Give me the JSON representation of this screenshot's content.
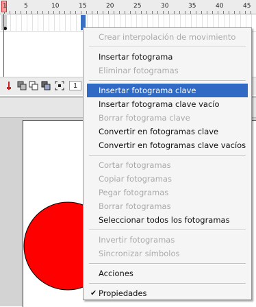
{
  "ruler": {
    "labels": [
      "1",
      "5",
      "10",
      "15",
      "20",
      "25",
      "30",
      "35",
      "40",
      "45"
    ]
  },
  "timeline_toolbar": {
    "current_frame": "1",
    "icons": [
      "onion-skin-icon",
      "onion-skin-outline-icon",
      "edit-multiple-frames-icon",
      "modify-markers-icon"
    ]
  },
  "context_menu": {
    "groups": [
      [
        {
          "label": "Crear interpolación de movimiento",
          "enabled": false
        }
      ],
      [
        {
          "label": "Insertar fotograma",
          "enabled": true
        },
        {
          "label": "Eliminar fotogramas",
          "enabled": false
        }
      ],
      [
        {
          "label": "Insertar fotograma clave",
          "enabled": true,
          "highlighted": true
        },
        {
          "label": "Insertar fotograma clave vacío",
          "enabled": true
        },
        {
          "label": "Borrar fotograma clave",
          "enabled": false
        },
        {
          "label": "Convertir en fotogramas clave",
          "enabled": true
        },
        {
          "label": "Convertir en fotogramas clave vacíos",
          "enabled": true
        }
      ],
      [
        {
          "label": "Cortar fotogramas",
          "enabled": false
        },
        {
          "label": "Copiar fotogramas",
          "enabled": false
        },
        {
          "label": "Pegar fotogramas",
          "enabled": false
        },
        {
          "label": "Borrar fotogramas",
          "enabled": false
        },
        {
          "label": "Seleccionar todos los fotogramas",
          "enabled": true
        }
      ],
      [
        {
          "label": "Invertir fotogramas",
          "enabled": false
        },
        {
          "label": "Sincronizar símbolos",
          "enabled": false
        }
      ],
      [
        {
          "label": "Acciones",
          "enabled": true
        }
      ],
      [
        {
          "label": "Propiedades",
          "enabled": true,
          "checked": true
        }
      ]
    ]
  },
  "stage": {
    "shape": "circle",
    "fill_color": "#ff0000",
    "stroke_color": "#000000"
  },
  "colors": {
    "menu_highlight": "#316ac5",
    "playhead": "#e02020",
    "selected_frame": "#3a6fc3"
  }
}
